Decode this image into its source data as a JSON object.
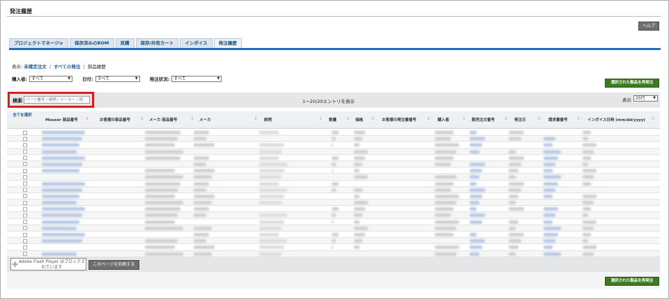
{
  "page": {
    "title": "発注履歴",
    "help_label": "ヘルプ"
  },
  "tabs": [
    {
      "label": "プロジェクトマネージャ"
    },
    {
      "label": "保存済みのBOM"
    },
    {
      "label": "見積"
    },
    {
      "label": "保存/共有カート"
    },
    {
      "label": "インボイス"
    },
    {
      "label": "発注履歴"
    }
  ],
  "display": {
    "prefix": "表示:",
    "unconfirmed": "未確定注文",
    "all_orders": "すべての発注",
    "parts_history": "部品履歴"
  },
  "filters": {
    "buyer_label": "購入者:",
    "buyer_value": "すべて",
    "date_label": "日付:",
    "date_value": "すべて",
    "status_label": "発注状況:",
    "status_value": "すべて"
  },
  "reorder_label": "選択された製品を再発注",
  "search": {
    "label": "検索",
    "placeholder": "パーツ番号 / 説明 / メーカー / 請"
  },
  "entries_text": "1～20/20エントリを表示",
  "show": {
    "label": "表示",
    "value": "25行"
  },
  "table": {
    "select_all": "全てを選択",
    "columns": [
      "Mouser 部品番号",
      "お客様の部品番号",
      "メーカ 部品番号",
      "メーカ",
      "説明",
      "数量",
      "価格",
      "お客様の発注書番号",
      "購入者",
      "販売注文番号",
      "発注日",
      "請求書番号",
      "インボイス日時 (mm/dd/yyyy)"
    ],
    "row_count": 20
  },
  "flash_text": "Adobe Flash Player はブロックされています",
  "print_label": "このページを印刷する"
}
